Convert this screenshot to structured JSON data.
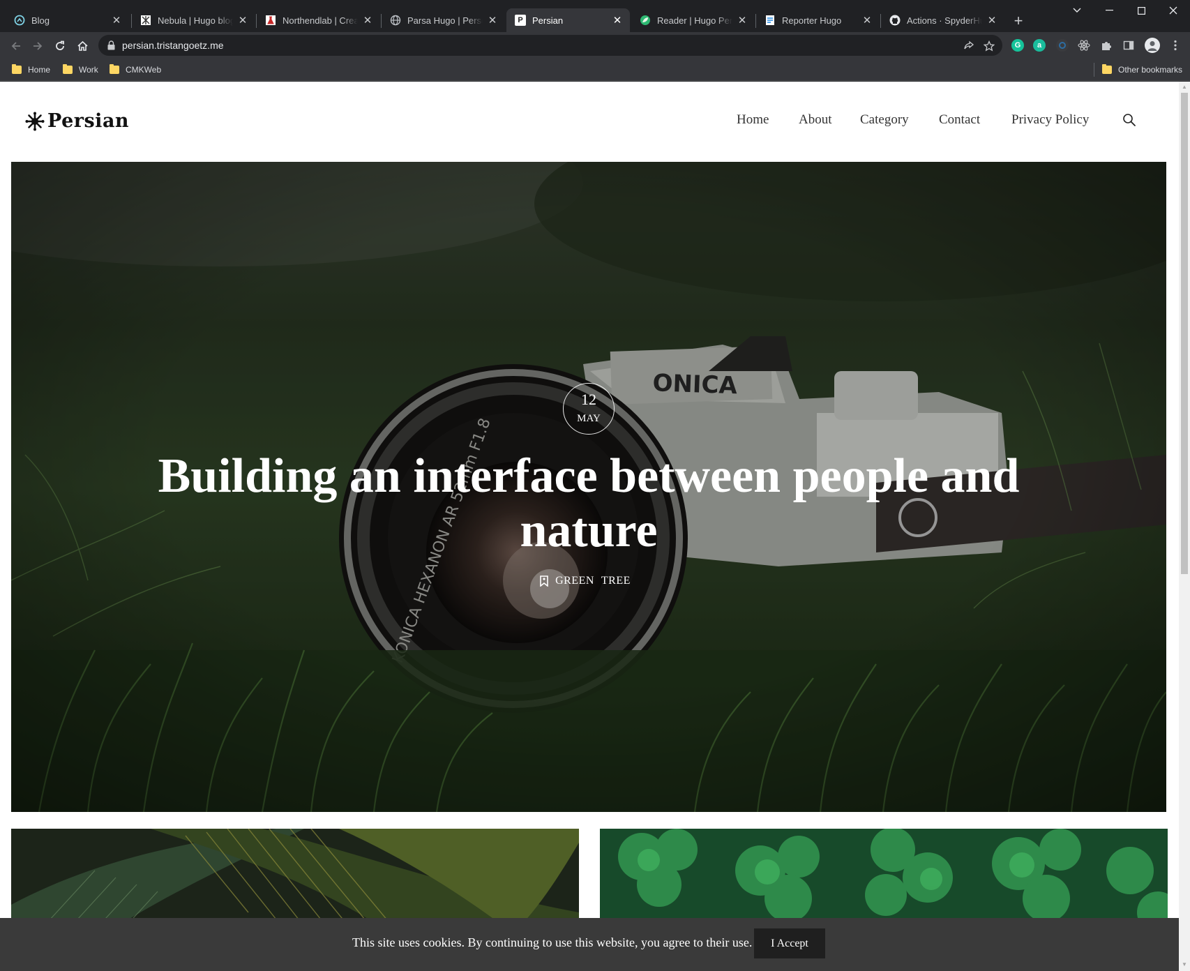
{
  "browser": {
    "tabs": [
      {
        "title": "Blog",
        "favicon": "circle-logo-icon",
        "active": false
      },
      {
        "title": "Nebula | Hugo blog theme",
        "favicon": "nebula-icon",
        "active": false
      },
      {
        "title": "Northendlab | Creative",
        "favicon": "flask-icon",
        "active": false
      },
      {
        "title": "Parsa Hugo | Personal",
        "favicon": "globe-icon",
        "active": false
      },
      {
        "title": "Persian",
        "favicon": "p-icon",
        "active": true
      },
      {
        "title": "Reader | Hugo Personal",
        "favicon": "leaf-icon",
        "active": false
      },
      {
        "title": "Reporter Hugo",
        "favicon": "document-icon",
        "active": false
      },
      {
        "title": "Actions · SpyderHunter",
        "favicon": "github-icon",
        "active": false
      }
    ],
    "favicon_letters": {
      "persian": "P"
    },
    "url": "persian.tristangoetz.me",
    "bookmarks": [
      "Home",
      "Work",
      "CMKWeb"
    ],
    "other_bookmarks": "Other bookmarks",
    "extension_letters": {
      "grammarly": "G",
      "a": "a"
    },
    "colors": {
      "tabstrip": "#202124",
      "toolbar": "#35363a",
      "folder": "#fdd663"
    }
  },
  "site": {
    "logo_text": "Persian",
    "nav": [
      "Home",
      "About",
      "Category",
      "Contact",
      "Privacy Policy"
    ],
    "hero": {
      "day": "12",
      "month": "MAY",
      "title": "Building an interface between people and nature",
      "tags": [
        "GREEN",
        "TREE"
      ]
    },
    "cookie": {
      "message": "This site uses cookies. By continuing to use this website, you agree to their use.",
      "button": "I Accept"
    },
    "colors": {
      "cookie_bar": "#3a3a3a",
      "accept_button": "#1f1f1f"
    }
  }
}
